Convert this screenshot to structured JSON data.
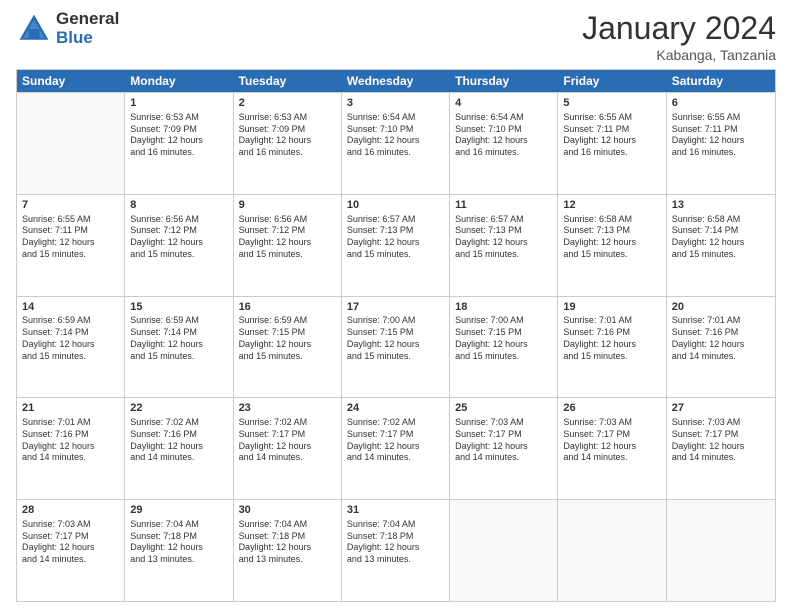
{
  "logo": {
    "general": "General",
    "blue": "Blue"
  },
  "title": "January 2024",
  "location": "Kabanga, Tanzania",
  "days": [
    "Sunday",
    "Monday",
    "Tuesday",
    "Wednesday",
    "Thursday",
    "Friday",
    "Saturday"
  ],
  "rows": [
    [
      {
        "day": "",
        "info": "",
        "empty": true
      },
      {
        "day": "1",
        "info": "Sunrise: 6:53 AM\nSunset: 7:09 PM\nDaylight: 12 hours\nand 16 minutes."
      },
      {
        "day": "2",
        "info": "Sunrise: 6:53 AM\nSunset: 7:09 PM\nDaylight: 12 hours\nand 16 minutes."
      },
      {
        "day": "3",
        "info": "Sunrise: 6:54 AM\nSunset: 7:10 PM\nDaylight: 12 hours\nand 16 minutes."
      },
      {
        "day": "4",
        "info": "Sunrise: 6:54 AM\nSunset: 7:10 PM\nDaylight: 12 hours\nand 16 minutes."
      },
      {
        "day": "5",
        "info": "Sunrise: 6:55 AM\nSunset: 7:11 PM\nDaylight: 12 hours\nand 16 minutes."
      },
      {
        "day": "6",
        "info": "Sunrise: 6:55 AM\nSunset: 7:11 PM\nDaylight: 12 hours\nand 16 minutes."
      }
    ],
    [
      {
        "day": "7",
        "info": "Sunrise: 6:55 AM\nSunset: 7:11 PM\nDaylight: 12 hours\nand 15 minutes."
      },
      {
        "day": "8",
        "info": "Sunrise: 6:56 AM\nSunset: 7:12 PM\nDaylight: 12 hours\nand 15 minutes."
      },
      {
        "day": "9",
        "info": "Sunrise: 6:56 AM\nSunset: 7:12 PM\nDaylight: 12 hours\nand 15 minutes."
      },
      {
        "day": "10",
        "info": "Sunrise: 6:57 AM\nSunset: 7:13 PM\nDaylight: 12 hours\nand 15 minutes."
      },
      {
        "day": "11",
        "info": "Sunrise: 6:57 AM\nSunset: 7:13 PM\nDaylight: 12 hours\nand 15 minutes."
      },
      {
        "day": "12",
        "info": "Sunrise: 6:58 AM\nSunset: 7:13 PM\nDaylight: 12 hours\nand 15 minutes."
      },
      {
        "day": "13",
        "info": "Sunrise: 6:58 AM\nSunset: 7:14 PM\nDaylight: 12 hours\nand 15 minutes."
      }
    ],
    [
      {
        "day": "14",
        "info": "Sunrise: 6:59 AM\nSunset: 7:14 PM\nDaylight: 12 hours\nand 15 minutes."
      },
      {
        "day": "15",
        "info": "Sunrise: 6:59 AM\nSunset: 7:14 PM\nDaylight: 12 hours\nand 15 minutes."
      },
      {
        "day": "16",
        "info": "Sunrise: 6:59 AM\nSunset: 7:15 PM\nDaylight: 12 hours\nand 15 minutes."
      },
      {
        "day": "17",
        "info": "Sunrise: 7:00 AM\nSunset: 7:15 PM\nDaylight: 12 hours\nand 15 minutes."
      },
      {
        "day": "18",
        "info": "Sunrise: 7:00 AM\nSunset: 7:15 PM\nDaylight: 12 hours\nand 15 minutes."
      },
      {
        "day": "19",
        "info": "Sunrise: 7:01 AM\nSunset: 7:16 PM\nDaylight: 12 hours\nand 15 minutes."
      },
      {
        "day": "20",
        "info": "Sunrise: 7:01 AM\nSunset: 7:16 PM\nDaylight: 12 hours\nand 14 minutes."
      }
    ],
    [
      {
        "day": "21",
        "info": "Sunrise: 7:01 AM\nSunset: 7:16 PM\nDaylight: 12 hours\nand 14 minutes."
      },
      {
        "day": "22",
        "info": "Sunrise: 7:02 AM\nSunset: 7:16 PM\nDaylight: 12 hours\nand 14 minutes."
      },
      {
        "day": "23",
        "info": "Sunrise: 7:02 AM\nSunset: 7:17 PM\nDaylight: 12 hours\nand 14 minutes."
      },
      {
        "day": "24",
        "info": "Sunrise: 7:02 AM\nSunset: 7:17 PM\nDaylight: 12 hours\nand 14 minutes."
      },
      {
        "day": "25",
        "info": "Sunrise: 7:03 AM\nSunset: 7:17 PM\nDaylight: 12 hours\nand 14 minutes."
      },
      {
        "day": "26",
        "info": "Sunrise: 7:03 AM\nSunset: 7:17 PM\nDaylight: 12 hours\nand 14 minutes."
      },
      {
        "day": "27",
        "info": "Sunrise: 7:03 AM\nSunset: 7:17 PM\nDaylight: 12 hours\nand 14 minutes."
      }
    ],
    [
      {
        "day": "28",
        "info": "Sunrise: 7:03 AM\nSunset: 7:17 PM\nDaylight: 12 hours\nand 14 minutes."
      },
      {
        "day": "29",
        "info": "Sunrise: 7:04 AM\nSunset: 7:18 PM\nDaylight: 12 hours\nand 13 minutes."
      },
      {
        "day": "30",
        "info": "Sunrise: 7:04 AM\nSunset: 7:18 PM\nDaylight: 12 hours\nand 13 minutes."
      },
      {
        "day": "31",
        "info": "Sunrise: 7:04 AM\nSunset: 7:18 PM\nDaylight: 12 hours\nand 13 minutes."
      },
      {
        "day": "",
        "info": "",
        "empty": true
      },
      {
        "day": "",
        "info": "",
        "empty": true
      },
      {
        "day": "",
        "info": "",
        "empty": true
      }
    ]
  ]
}
